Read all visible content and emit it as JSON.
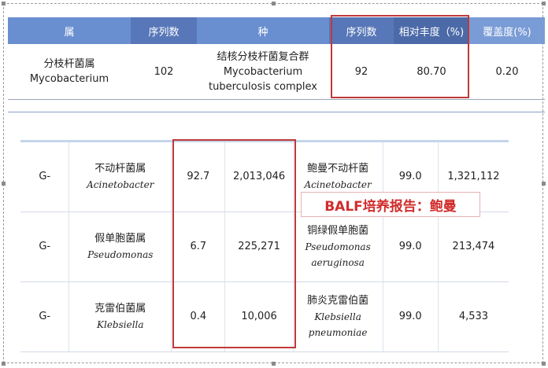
{
  "top_table": {
    "headers": [
      "属",
      "序列数",
      "种",
      "序列数",
      "相对丰度（%)",
      "覆盖度(%)"
    ],
    "row": {
      "genus_cn": "分枝杆菌属",
      "genus_en": "Mycobacterium",
      "genus_seq": "102",
      "species_cn": "结核分枝杆菌复合群",
      "species_en_1": "Mycobacterium",
      "species_en_2": "tuberculosis complex",
      "species_seq": "92",
      "abundance": "80.70",
      "coverage": "0.20"
    }
  },
  "bottom_table": {
    "rows": [
      {
        "type": "G-",
        "genus_cn": "不动杆菌属",
        "genus_en": "Acinetobacter",
        "pct": "92.7",
        "count": "2,013,046",
        "species_cn": "鲍曼不动杆菌",
        "species_en_1": "Acinetobacter",
        "species_en_2": "",
        "pct2": "99.0",
        "count2": "1,321,112"
      },
      {
        "type": "G-",
        "genus_cn": "假单胞菌属",
        "genus_en": "Pseudomonas",
        "pct": "6.7",
        "count": "225,271",
        "species_cn": "铜绿假单胞菌",
        "species_en_1": "Pseudomonas",
        "species_en_2": "aeruginosa",
        "pct2": "99.0",
        "count2": "213,474"
      },
      {
        "type": "G-",
        "genus_cn": "克雷伯菌属",
        "genus_en": "Klebsiella",
        "pct": "0.4",
        "count": "10,006",
        "species_cn": "肺炎克雷伯菌",
        "species_en_1": "Klebsiella",
        "species_en_2": "pneumoniae",
        "pct2": "99.0",
        "count2": "4,533"
      }
    ]
  },
  "callout": {
    "text": "BALF培养报告：鲍曼"
  },
  "colors": {
    "highlight_red": "#c0393b",
    "callout_text": "#d12c2c"
  }
}
